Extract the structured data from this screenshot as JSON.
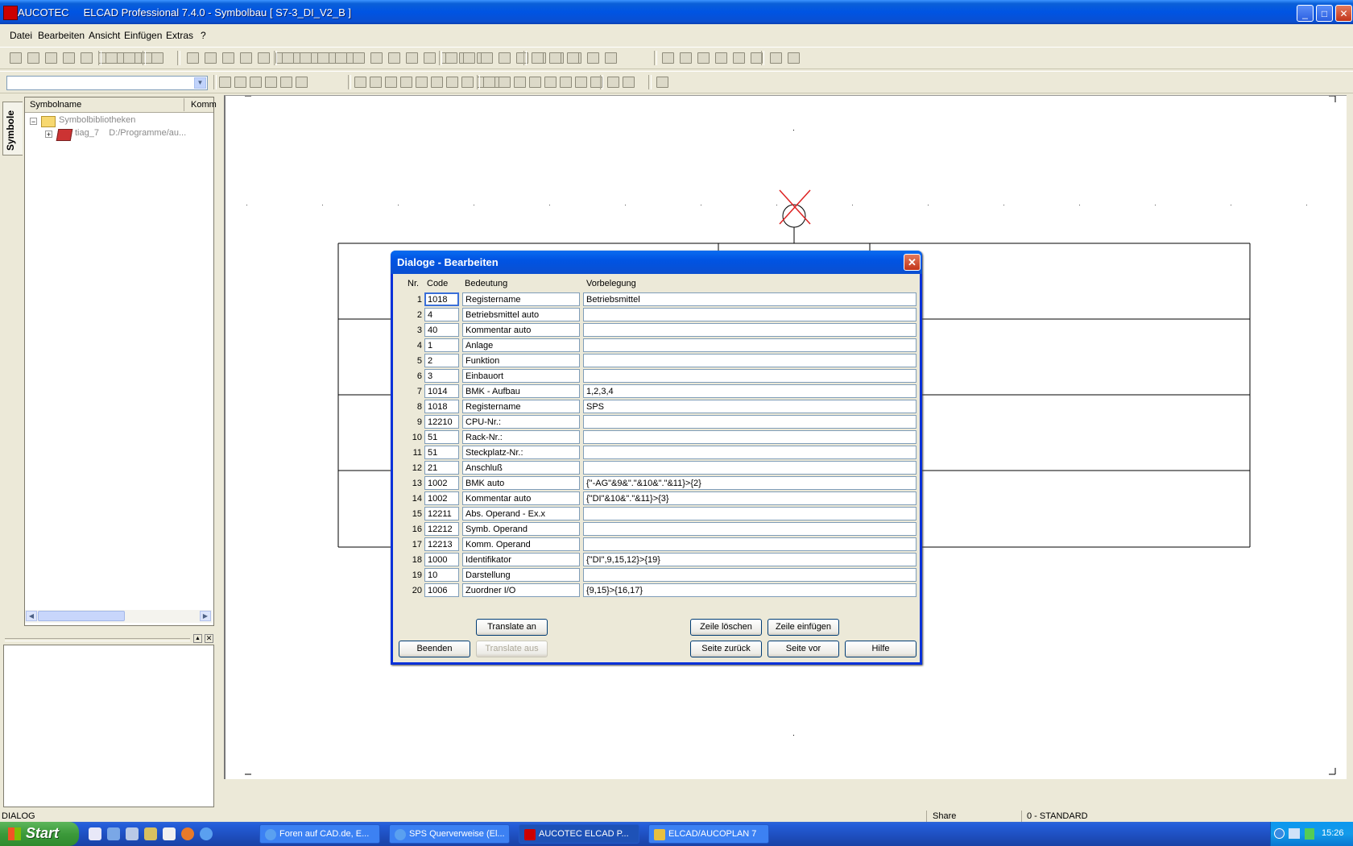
{
  "window": {
    "title": "AUCOTEC     ELCAD Professional 7.4.0 - Symbolbau [ S7-3_DI_V2_B ]"
  },
  "menu": [
    "Datei",
    "Bearbeiten",
    "Ansicht",
    "Einfügen",
    "Extras",
    "?"
  ],
  "left_panel": {
    "tab_label": "Symbole",
    "col_name": "Symbolname",
    "col_comment": "Komm",
    "tree": [
      {
        "label": "Symbolbibliotheken"
      },
      {
        "label": "tiag_7    D:/Programme/au..."
      }
    ]
  },
  "dialog": {
    "title": "Dialoge - Bearbeiten",
    "headers": {
      "nr": "Nr.",
      "code": "Code",
      "bedeutung": "Bedeutung",
      "vorbelegung": "Vorbelegung"
    },
    "rows": [
      {
        "nr": "1",
        "code": "1018",
        "bedeutung": "Registername",
        "vorbelegung": "Betriebsmittel"
      },
      {
        "nr": "2",
        "code": "4",
        "bedeutung": "Betriebsmittel auto",
        "vorbelegung": ""
      },
      {
        "nr": "3",
        "code": "40",
        "bedeutung": "Kommentar auto",
        "vorbelegung": ""
      },
      {
        "nr": "4",
        "code": "1",
        "bedeutung": "Anlage",
        "vorbelegung": ""
      },
      {
        "nr": "5",
        "code": "2",
        "bedeutung": "Funktion",
        "vorbelegung": ""
      },
      {
        "nr": "6",
        "code": "3",
        "bedeutung": "Einbauort",
        "vorbelegung": ""
      },
      {
        "nr": "7",
        "code": "1014",
        "bedeutung": "BMK - Aufbau",
        "vorbelegung": "1,2,3,4"
      },
      {
        "nr": "8",
        "code": "1018",
        "bedeutung": "Registername",
        "vorbelegung": "SPS"
      },
      {
        "nr": "9",
        "code": "12210",
        "bedeutung": "CPU-Nr.:",
        "vorbelegung": ""
      },
      {
        "nr": "10",
        "code": "51",
        "bedeutung": "Rack-Nr.:",
        "vorbelegung": ""
      },
      {
        "nr": "11",
        "code": "51",
        "bedeutung": "Steckplatz-Nr.:",
        "vorbelegung": ""
      },
      {
        "nr": "12",
        "code": "21",
        "bedeutung": "Anschluß",
        "vorbelegung": ""
      },
      {
        "nr": "13",
        "code": "1002",
        "bedeutung": "BMK auto",
        "vorbelegung": "{\"-AG\"&9&\".\"&10&\".\"&11}>{2}"
      },
      {
        "nr": "14",
        "code": "1002",
        "bedeutung": "Kommentar auto",
        "vorbelegung": "{\"DI\"&10&\".\"&11}>{3}"
      },
      {
        "nr": "15",
        "code": "12211",
        "bedeutung": "Abs. Operand - Ex.x",
        "vorbelegung": ""
      },
      {
        "nr": "16",
        "code": "12212",
        "bedeutung": "Symb. Operand",
        "vorbelegung": ""
      },
      {
        "nr": "17",
        "code": "12213",
        "bedeutung": "Komm. Operand",
        "vorbelegung": ""
      },
      {
        "nr": "18",
        "code": "1000",
        "bedeutung": "Identifikator",
        "vorbelegung": "{\"DI\",9,15,12}>{19}"
      },
      {
        "nr": "19",
        "code": "10",
        "bedeutung": "Darstellung",
        "vorbelegung": ""
      },
      {
        "nr": "20",
        "code": "1006",
        "bedeutung": "Zuordner I/O",
        "vorbelegung": "{9,15}>{16,17}"
      }
    ],
    "buttons": {
      "translate_an": "Translate an",
      "zeile_loeschen": "Zeile löschen",
      "zeile_einfuegen": "Zeile einfügen",
      "beenden": "Beenden",
      "translate_aus": "Translate aus",
      "seite_zurueck": "Seite zurück",
      "seite_vor": "Seite vor",
      "hilfe": "Hilfe"
    }
  },
  "status": {
    "left": "DIALOG",
    "share": "Share",
    "layer": "0 - STANDARD"
  },
  "taskbar": {
    "start": "Start",
    "tasks": [
      {
        "label": "Foren auf CAD.de, E..."
      },
      {
        "label": "SPS Querverweise (El..."
      },
      {
        "label": "AUCOTEC    ELCAD P..."
      },
      {
        "label": "ELCAD/AUCOPLAN 7"
      }
    ],
    "clock": "15:26"
  }
}
